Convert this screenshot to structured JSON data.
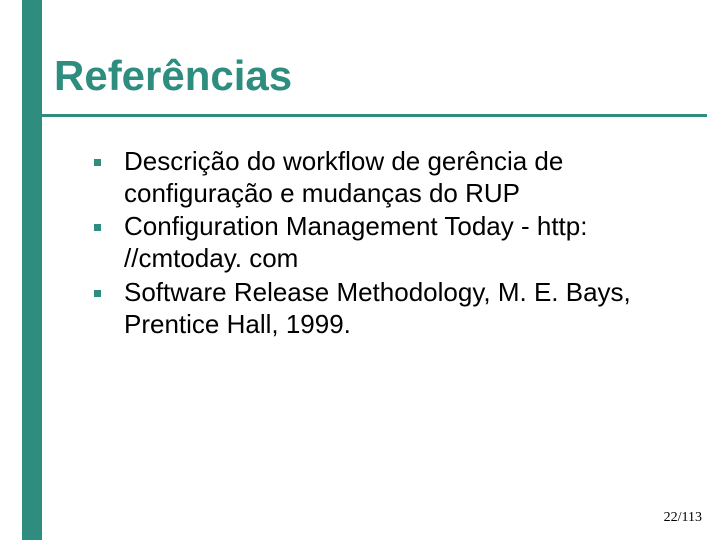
{
  "slide": {
    "title": "Referências",
    "bullets": [
      "Descrição do workflow de gerência de configuração e mudanças do RUP",
      "Configuration Management Today - http: //cmtoday. com",
      "Software Release Methodology, M. E. Bays, Prentice Hall, 1999."
    ],
    "page_number": "22/113"
  }
}
